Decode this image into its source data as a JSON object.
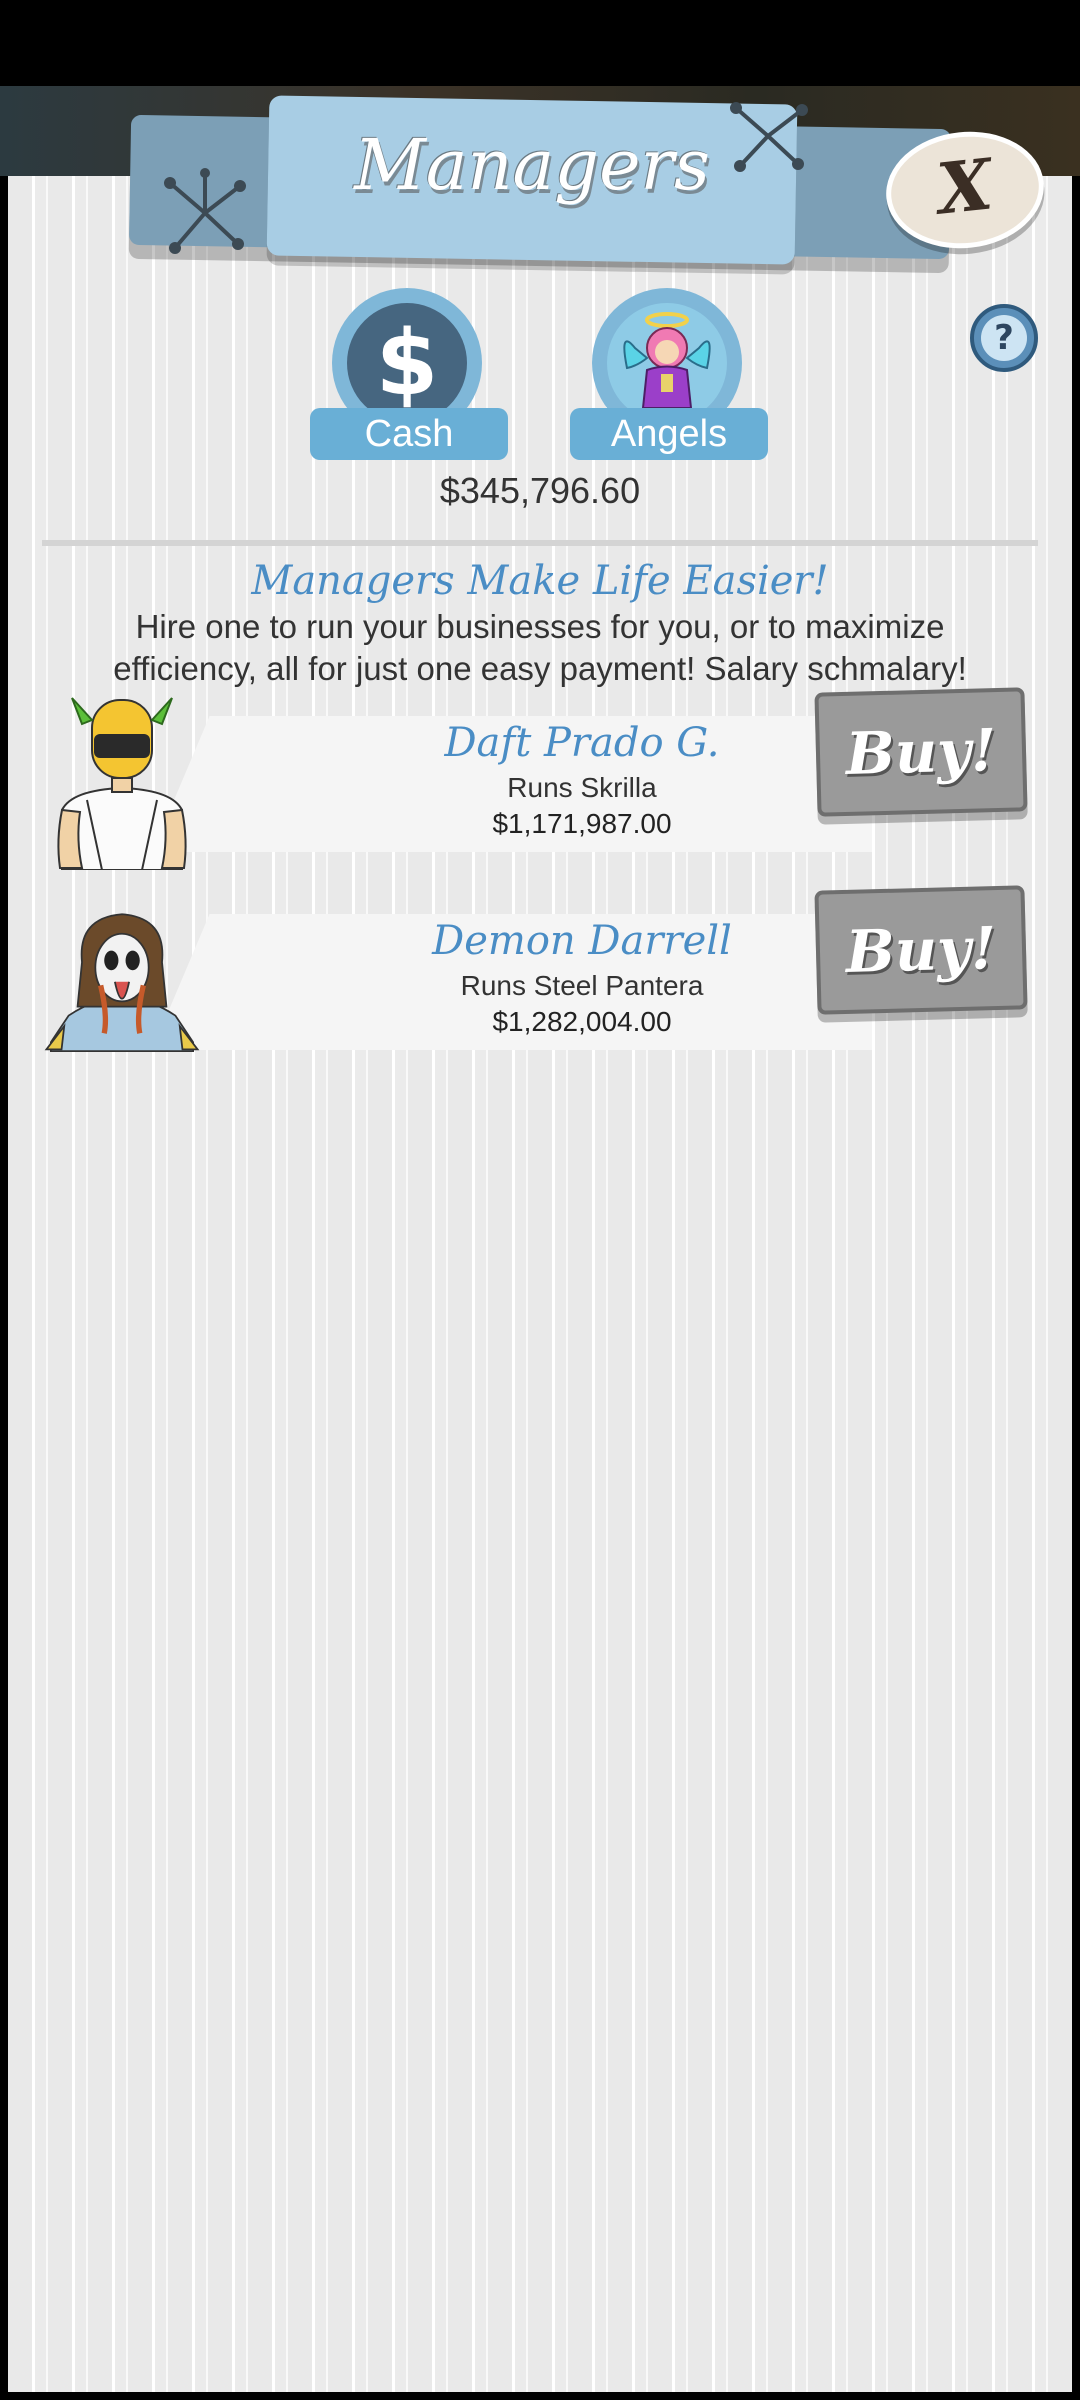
{
  "header": {
    "title": "Managers",
    "close_label": "X",
    "help_label": "?"
  },
  "currencies": [
    {
      "label": "Cash",
      "icon": "dollar-icon",
      "symbol": "$"
    },
    {
      "label": "Angels",
      "icon": "angel-icon"
    }
  ],
  "cash_amount": "$345,796.60",
  "info": {
    "slogan": "Managers Make Life Easier!",
    "description": "Hire one to run your businesses for you, or to maximize efficiency, all for just one easy payment! Salary schmalary!"
  },
  "managers": [
    {
      "name": "Daft Prado G.",
      "runs": "Runs Skrilla",
      "cost": "$1,171,987.00",
      "buy_label": "Buy!"
    },
    {
      "name": "Demon Darrell",
      "runs": "Runs Steel Pantera",
      "cost": "$1,282,004.00",
      "buy_label": "Buy!"
    }
  ],
  "colors": {
    "accent_blue": "#4a8dc5",
    "tab_blue": "#69afd6",
    "banner": "#a8cde4",
    "buy_button": "#9a9a9a"
  }
}
